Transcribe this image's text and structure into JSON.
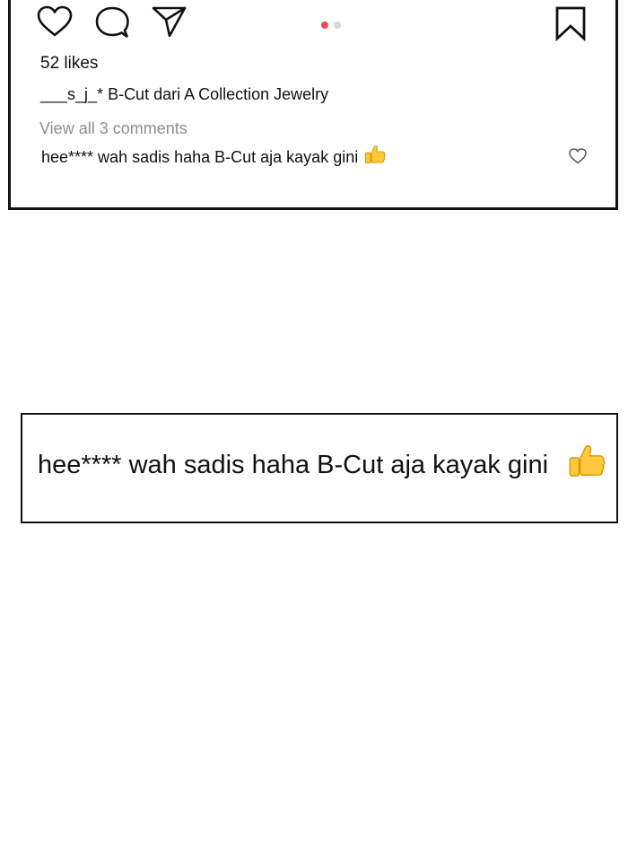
{
  "post": {
    "likes": "52 likes",
    "caption_user": "___s_j_*",
    "caption_text": "B-Cut dari A Collection Jewelry",
    "view_comments": "View all 3 comments",
    "comment_text": "hee**** wah sadis haha B-Cut aja kayak gini",
    "comment_emoji": "thumbs-up",
    "carousel": {
      "count": 2,
      "active_index": 0,
      "active_color": "#ed4956",
      "inactive_color": "#d8d8d8"
    }
  },
  "icons": {
    "like": "heart-icon",
    "comment": "comment-bubble-icon",
    "share": "paper-plane-icon",
    "save": "bookmark-icon",
    "comment_like": "small-heart-icon"
  },
  "zoom": {
    "comment_text": "hee**** wah sadis haha B-Cut aja kayak gini",
    "emoji": "thumbs-up"
  },
  "colors": {
    "border": "#111111",
    "muted_text": "#8e8e8e",
    "emoji_yellow": "#ffc83d"
  }
}
